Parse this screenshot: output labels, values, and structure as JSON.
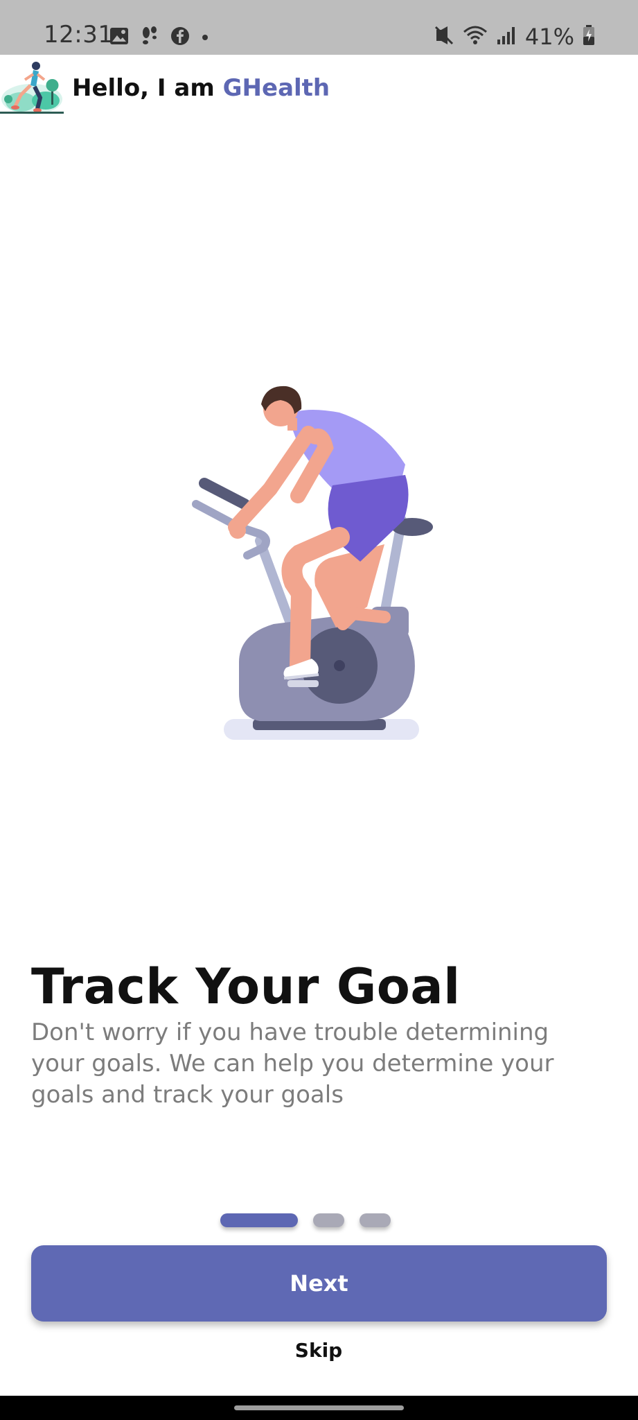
{
  "status_bar": {
    "time": "12:31",
    "battery": "41%",
    "left_icons": [
      "gallery-icon",
      "steps-icon",
      "facebook-icon",
      "dot-icon"
    ],
    "right_icons": [
      "mute-icon",
      "wifi-icon",
      "signal-icon",
      "battery-icon"
    ]
  },
  "header": {
    "greeting": "Hello, I am ",
    "brand": "GHealth",
    "brand_color": "#5d67b3"
  },
  "onboarding": {
    "title": "Track Your Goal",
    "description": "Don't worry if you have trouble determining your goals. We can help you determine your goals and track your goals",
    "page_count": 3,
    "current_page": 1
  },
  "actions": {
    "next_label": "Next",
    "skip_label": "Skip"
  },
  "colors": {
    "primary": "#5f69b4",
    "indicator_inactive": "#a9a9b6"
  }
}
